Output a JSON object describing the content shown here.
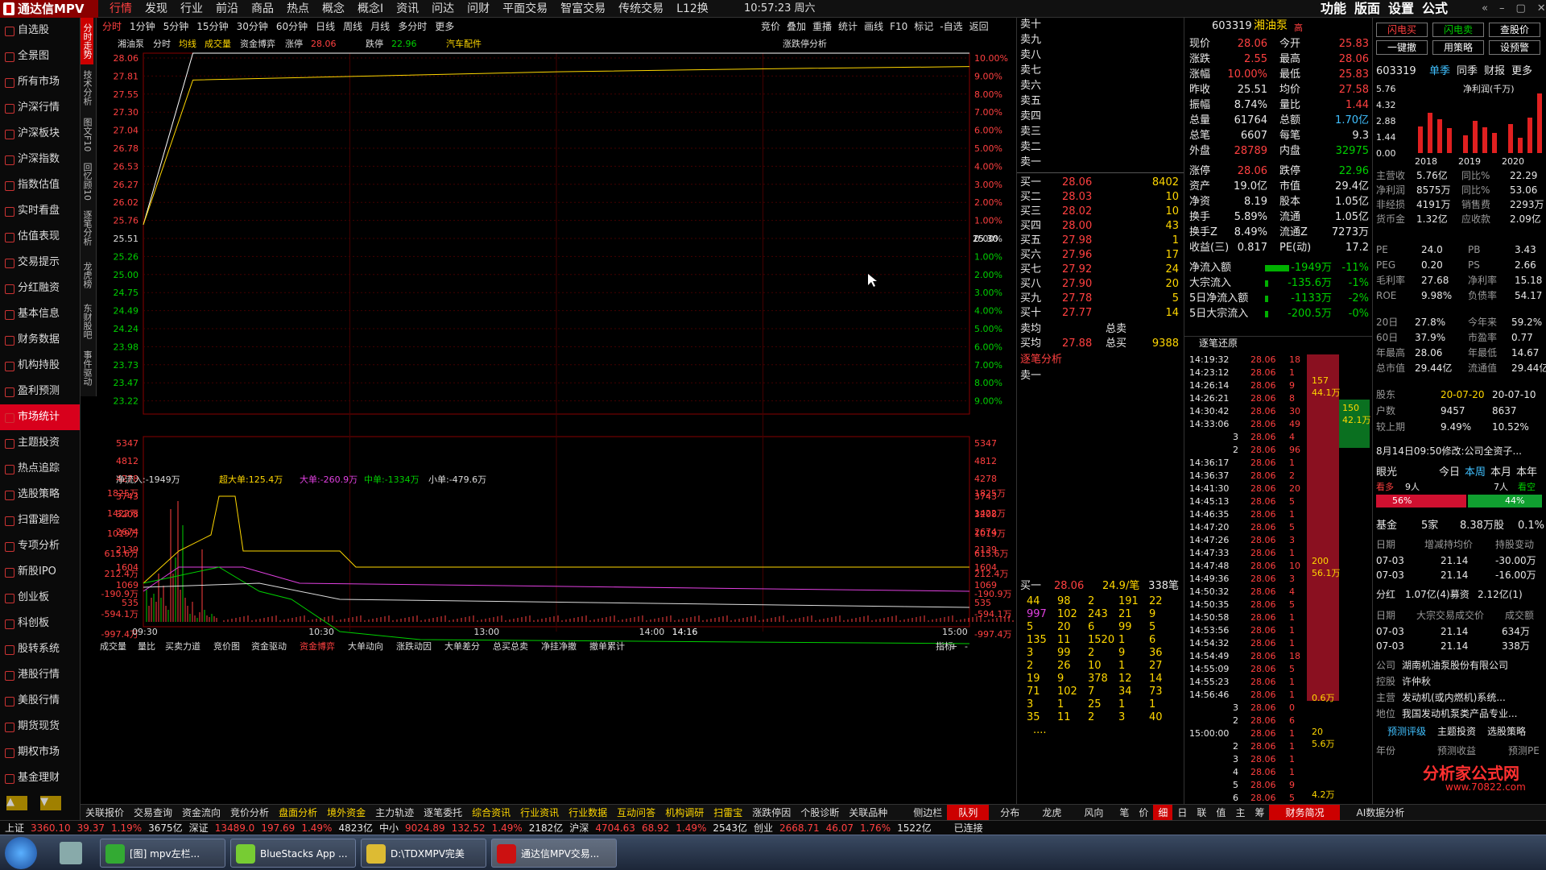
{
  "app": {
    "title": "通达信MPV",
    "time": "10:57:23",
    "weekday": "周六"
  },
  "menu": [
    "行情",
    "发现",
    "行业",
    "前沿",
    "商品",
    "热点",
    "概念",
    "概念I",
    "资讯",
    "问达",
    "问财",
    "平面交易",
    "智富交易",
    "传统交易",
    "L12换"
  ],
  "topright": [
    "功能",
    "版面",
    "设置",
    "公式"
  ],
  "sidebar": [
    "自选股",
    "全景图",
    "所有市场",
    "沪深行情",
    "沪深板块",
    "沪深指数",
    "指数估值",
    "实时看盘",
    "估值表现",
    "交易提示",
    "分红融资",
    "基本信息",
    "财务数据",
    "机构持股",
    "盈利预测",
    "市场统计",
    "主题投资",
    "热点追踪",
    "选股策略",
    "扫雷避险",
    "专项分析",
    "新股IPO",
    "创业板",
    "科创板",
    "股转系统",
    "港股行情",
    "美股行情",
    "期货现货",
    "期权市场",
    "基金理财"
  ],
  "vtabs": [
    "分时走势",
    "技术分析",
    "图文F10",
    "回忆顾10",
    "逐笔分析",
    "龙虎榜",
    "东财股吧",
    "事件驱动"
  ],
  "period_tabs": [
    "分时",
    "1分钟",
    "5分钟",
    "15分钟",
    "30分钟",
    "60分钟",
    "日线",
    "周线",
    "月线",
    "多分时",
    "更多"
  ],
  "tools": [
    "竞价",
    "叠加",
    "重播",
    "统计",
    "画线",
    "F10",
    "标记",
    "-自选",
    "返回"
  ],
  "chart_header": {
    "name": "湘油泵",
    "mode": "分时",
    "items": [
      "均线",
      "成交量",
      "资金博弈"
    ],
    "zt_label": "涨停",
    "zt": "28.06",
    "dt_label": "跌停",
    "dt": "22.96",
    "concept": "汽车配件",
    "analysis": "涨跌停分析"
  },
  "price_axis": {
    "left": [
      "28.06",
      "27.81",
      "27.55",
      "27.30",
      "27.04",
      "26.78",
      "26.53",
      "26.27",
      "26.02",
      "25.76",
      "25.51",
      "25.26",
      "25.00",
      "24.75",
      "24.49",
      "24.24",
      "23.98",
      "23.73",
      "23.47",
      "23.22"
    ],
    "right": [
      "10.00%",
      "9.00%",
      "8.00%",
      "7.00%",
      "6.00%",
      "5.00%",
      "4.00%",
      "3.00%",
      "2.00%",
      "1.00%",
      "0.00%",
      "1.00%",
      "2.00%",
      "3.00%",
      "4.00%",
      "5.00%",
      "6.00%",
      "7.00%",
      "8.00%",
      "9.00%"
    ],
    "cursor": "25.30"
  },
  "vol_axis": [
    "5347",
    "4812",
    "4278",
    "3743",
    "3208",
    "2674",
    "2139",
    "1604",
    "1069",
    "535"
  ],
  "flow_header": {
    "net": "净流入:-1949万",
    "big1": "超大单:125.4万",
    "big2": "大单:-260.9万",
    "mid": "中单:-1334万",
    "small": "小单:-479.6万"
  },
  "flow_axis": [
    "1825万",
    "1422万",
    "1019万",
    "615.6万",
    "212.4万",
    "-190.9万",
    "-594.1万",
    "-997.4万"
  ],
  "time_axis": [
    "09:30",
    "10:30",
    "13:00",
    "14:00",
    "14:16",
    "15:00"
  ],
  "chart_data": {
    "type": "line",
    "x": [
      "09:30",
      "10:30",
      "13:00",
      "14:00",
      "15:00"
    ],
    "series": [
      {
        "name": "价格",
        "values": [
          25.76,
          28.06,
          28.06,
          28.06,
          28.06
        ]
      },
      {
        "name": "均线",
        "values": [
          25.76,
          27.7,
          27.81,
          27.85,
          27.88
        ]
      }
    ],
    "ylim": [
      23.22,
      28.06
    ]
  },
  "chart_bottom_tabs": [
    "成交量",
    "量比",
    "买卖力道",
    "竞价图",
    "资金驱动",
    "资金博弈",
    "大单动向",
    "涨跌动因",
    "大单差分",
    "总买总卖",
    "净挂净撤",
    "撤单累计"
  ],
  "chart_bottom_right": [
    "指标",
    "+",
    "-"
  ],
  "sell": [
    {
      "l": "卖十"
    },
    {
      "l": "卖九"
    },
    {
      "l": "卖八"
    },
    {
      "l": "卖七"
    },
    {
      "l": "卖六"
    },
    {
      "l": "卖五"
    },
    {
      "l": "卖四"
    },
    {
      "l": "卖三"
    },
    {
      "l": "卖二"
    },
    {
      "l": "卖一"
    }
  ],
  "buy": [
    {
      "l": "买一",
      "p": "28.06",
      "v": "8402"
    },
    {
      "l": "买二",
      "p": "28.03",
      "v": "10"
    },
    {
      "l": "买三",
      "p": "28.02",
      "v": "10"
    },
    {
      "l": "买四",
      "p": "28.00",
      "v": "43"
    },
    {
      "l": "买五",
      "p": "27.98",
      "v": "1"
    },
    {
      "l": "买六",
      "p": "27.96",
      "v": "17"
    },
    {
      "l": "买七",
      "p": "27.92",
      "v": "24"
    },
    {
      "l": "买八",
      "p": "27.90",
      "v": "20"
    },
    {
      "l": "买九",
      "p": "27.78",
      "v": "5"
    },
    {
      "l": "买十",
      "p": "27.77",
      "v": "14"
    }
  ],
  "avg": {
    "sell_l": "卖均",
    "sell_t": "总卖",
    "buy_l": "买均",
    "buy_p": "27.88",
    "buy_t": "总买",
    "buy_v": "9388"
  },
  "zb": {
    "title": "逐笔分析",
    "sell1": "卖一",
    "buy1": "买一",
    "buy1_p": "28.06",
    "per": "24.9/笔",
    "cnt": "338笔"
  },
  "queue": [
    [
      "44",
      "98",
      "2",
      "191",
      "22"
    ],
    [
      "997",
      "102",
      "243",
      "21",
      "9"
    ],
    [
      "5",
      "20",
      "6",
      "99",
      "5"
    ],
    [
      "135",
      "11",
      "1520",
      "1",
      "6"
    ],
    [
      "3",
      "99",
      "2",
      "9",
      "36"
    ],
    [
      "2",
      "26",
      "10",
      "1",
      "27"
    ],
    [
      "19",
      "9",
      "378",
      "12",
      "14"
    ],
    [
      "71",
      "102",
      "7",
      "34",
      "73"
    ],
    [
      "3",
      "1",
      "25",
      "1",
      "1"
    ],
    [
      "35",
      "11",
      "2",
      "3",
      "40"
    ]
  ],
  "queue_more": "....",
  "stock": {
    "code": "603319",
    "name": "湘油泵",
    "flag": "高"
  },
  "quote": [
    [
      "现价",
      "28.06",
      "r",
      "今开",
      "25.83",
      "r"
    ],
    [
      "涨跌",
      "2.55",
      "r",
      "最高",
      "28.06",
      "r"
    ],
    [
      "涨幅",
      "10.00%",
      "r",
      "最低",
      "25.83",
      "r"
    ],
    [
      "昨收",
      "25.51",
      "w",
      "均价",
      "27.58",
      "r"
    ],
    [
      "振幅",
      "8.74%",
      "w",
      "量比",
      "1.44",
      "r"
    ],
    [
      "总量",
      "61764",
      "w",
      "总额",
      "1.70亿",
      "c"
    ],
    [
      "总笔",
      "6607",
      "w",
      "每笔",
      "9.3",
      "w"
    ],
    [
      "外盘",
      "28789",
      "r",
      "内盘",
      "32975",
      "g"
    ],
    [
      "涨停",
      "28.06",
      "r",
      "跌停",
      "22.96",
      "g"
    ],
    [
      "资产",
      "19.0亿",
      "w",
      "市值",
      "29.4亿",
      "w"
    ],
    [
      "净资",
      "8.19",
      "w",
      "股本",
      "1.05亿",
      "w"
    ],
    [
      "换手",
      "5.89%",
      "w",
      "流通",
      "1.05亿",
      "w"
    ],
    [
      "换手Z",
      "8.49%",
      "w",
      "流通Z",
      "7273万",
      "w"
    ],
    [
      "收益(三)",
      "0.817",
      "w",
      "PE(动)",
      "17.2",
      "w"
    ]
  ],
  "flows": [
    [
      "净流入额",
      "-1949万",
      "-11%"
    ],
    [
      "大宗流入",
      "-135.6万",
      "-1%"
    ],
    [
      "5日净流入额",
      "-1133万",
      "-2%"
    ],
    [
      "5日大宗流入",
      "-200.5万",
      "-0%"
    ]
  ],
  "ticks_title": "逐笔还原",
  "ticks": [
    [
      "14:19:32",
      "28.06",
      "18"
    ],
    [
      "14:23:12",
      "28.06",
      "1"
    ],
    [
      "14:26:14",
      "28.06",
      "9"
    ],
    [
      "14:26:21",
      "28.06",
      "8"
    ],
    [
      "14:30:42",
      "28.06",
      "30"
    ],
    [
      "14:33:06",
      "28.06",
      "49"
    ],
    [
      "3",
      "28.06",
      "4"
    ],
    [
      "2",
      "28.06",
      "96"
    ],
    [
      "14:36:17",
      "28.06",
      "1"
    ],
    [
      "14:36:37",
      "28.06",
      "2"
    ],
    [
      "14:41:30",
      "28.06",
      "20"
    ],
    [
      "14:45:13",
      "28.06",
      "5"
    ],
    [
      "14:46:35",
      "28.06",
      "1"
    ],
    [
      "14:47:20",
      "28.06",
      "5"
    ],
    [
      "14:47:26",
      "28.06",
      "3"
    ],
    [
      "14:47:33",
      "28.06",
      "1"
    ],
    [
      "14:47:48",
      "28.06",
      "10"
    ],
    [
      "14:49:36",
      "28.06",
      "3"
    ],
    [
      "14:50:32",
      "28.06",
      "4"
    ],
    [
      "14:50:35",
      "28.06",
      "5"
    ],
    [
      "14:50:58",
      "28.06",
      "1"
    ],
    [
      "14:53:56",
      "28.06",
      "1"
    ],
    [
      "14:54:32",
      "28.06",
      "1"
    ],
    [
      "14:54:49",
      "28.06",
      "18"
    ],
    [
      "14:55:09",
      "28.06",
      "5"
    ],
    [
      "14:55:23",
      "28.06",
      "1"
    ],
    [
      "14:56:46",
      "28.06",
      "1"
    ],
    [
      "3",
      "28.06",
      "0"
    ],
    [
      "2",
      "28.06",
      "6"
    ],
    [
      "15:00:00",
      "28.06",
      "1"
    ],
    [
      "2",
      "28.06",
      "1"
    ],
    [
      "3",
      "28.06",
      "1"
    ],
    [
      "4",
      "28.06",
      "1"
    ],
    [
      "5",
      "28.06",
      "9"
    ],
    [
      "6",
      "28.06",
      "5"
    ]
  ],
  "tick_marks": [
    [
      "157",
      "44.1万"
    ],
    [
      "150",
      "42.1万"
    ],
    [
      "200",
      "56.1万"
    ],
    [
      "20",
      "5.6万"
    ],
    [
      "0.6万"
    ],
    [
      "4.2万"
    ]
  ],
  "far_btns": [
    "闪电买",
    "闪电卖",
    "查股价",
    "一键撤",
    "用策略",
    "设预警"
  ],
  "far_stock": "603319",
  "far_tabs": [
    "单季",
    "同季",
    "财报",
    "更多"
  ],
  "profit": {
    "title": "净利润(千万)",
    "y": [
      "5.76",
      "4.32",
      "2.88",
      "1.44",
      "0.00"
    ],
    "years": [
      "2018",
      "2019",
      "2020"
    ],
    "bars": [
      2.4,
      3.6,
      3.0,
      2.2,
      1.6,
      2.9,
      2.3,
      1.8,
      2.6,
      1.4,
      3.2,
      5.3
    ]
  },
  "fin": [
    [
      "主营收",
      "5.76亿",
      "同比%",
      "22.29"
    ],
    [
      "净利润",
      "8575万",
      "同比%",
      "53.06"
    ],
    [
      "非经损",
      "4191万",
      "销售费",
      "2293万"
    ],
    [
      "货币金",
      "1.32亿",
      "应收款",
      "2.09亿"
    ]
  ],
  "val": [
    [
      "PE",
      "24.0",
      "PB",
      "3.43"
    ],
    [
      "PEG",
      "0.20",
      "PS",
      "2.66"
    ],
    [
      "毛利率",
      "27.68",
      "净利率",
      "15.18"
    ],
    [
      "ROE",
      "9.98%",
      "负债率",
      "54.17"
    ]
  ],
  "perf": [
    [
      "20日",
      "27.8%",
      "今年来",
      "59.2%"
    ],
    [
      "60日",
      "37.9%",
      "市盈率",
      "0.77"
    ],
    [
      "年最高",
      "28.06",
      "年最低",
      "14.67"
    ],
    [
      "总市值",
      "29.44亿",
      "流通值",
      "29.44亿"
    ]
  ],
  "holder": [
    [
      "股东",
      "20-07-20",
      "20-07-10"
    ],
    [
      "户数",
      "9457",
      "8637"
    ],
    [
      "较上期",
      "9.49%",
      "10.52%"
    ]
  ],
  "notice": "8月14日09:50修改:公司全资子...",
  "vision": {
    "label": "眼光",
    "tabs": [
      "今日",
      "本周",
      "本月",
      "本年"
    ],
    "bull": "看多",
    "bull_n": "9人",
    "bear_n": "7人",
    "bear": "看空",
    "p1": "56%",
    "p2": "44%"
  },
  "fund": {
    "label": "基金",
    "n": "5家",
    "v": "8.38万股",
    "p": "0.1%"
  },
  "inc": {
    "h": [
      "日期",
      "增减持均价",
      "持股变动"
    ],
    "rows": [
      [
        "07-03",
        "21.14",
        "-30.00万"
      ],
      [
        "07-03",
        "21.14",
        "-16.00万"
      ]
    ]
  },
  "div": [
    "分红",
    "1.07亿(4)募资",
    "2.12亿(1)"
  ],
  "blk": {
    "h": [
      "日期",
      "大宗交易成交价",
      "成交额"
    ],
    "rows": [
      [
        "07-03",
        "21.14",
        "634万"
      ],
      [
        "07-03",
        "21.14",
        "338万"
      ]
    ]
  },
  "comp": [
    [
      "公司",
      "湖南机油泵股份有限公司"
    ],
    [
      "控股",
      "许仲秋"
    ],
    [
      "主营",
      "发动机(或内燃机)系统..."
    ],
    [
      "地位",
      "我国发动机泵类产品专业..."
    ]
  ],
  "far_links": [
    "预测评级",
    "主题投资",
    "选股策略"
  ],
  "far_foot": [
    "年份",
    "预测收益",
    "预测PE"
  ],
  "bottom": [
    "关联报价",
    "交易查询",
    "资金流向",
    "竞价分析",
    "盘面分析",
    "境外资金",
    "主力轨迹",
    "逐笔委托",
    "综合资讯",
    "行业资讯",
    "行业数据",
    "互动问答",
    "机构调研",
    "扫雷宝",
    "涨跌停因",
    "个股诊断",
    "关联品种"
  ],
  "bottom_mid": "侧边栏",
  "bottom_tabs": [
    "队列",
    "分布",
    "龙虎",
    "风向"
  ],
  "bottom_tabs2": [
    "笔",
    "价",
    "细",
    "日",
    "联",
    "值",
    "主",
    "筹"
  ],
  "bottom_right": [
    "财务简况",
    "AI数据分析"
  ],
  "status": [
    [
      "上证",
      "3360.10",
      "39.37",
      "1.19%",
      "3675亿"
    ],
    [
      "深证",
      "13489.0",
      "197.69",
      "1.49%",
      "4823亿"
    ],
    [
      "中小",
      "9024.89",
      "132.52",
      "1.49%",
      "2182亿"
    ],
    [
      "沪深",
      "4704.63",
      "68.92",
      "1.49%",
      "2543亿"
    ],
    [
      "创业",
      "2668.71",
      "46.07",
      "1.76%",
      "1522亿"
    ]
  ],
  "conn": "已连接",
  "tasks": [
    "[图] mpv左栏...",
    "BlueStacks App ...",
    "D:\\TDXMPV完美",
    "通达信MPV交易..."
  ],
  "watermark": "分析家公式网",
  "watermark_url": "www.70822.com"
}
